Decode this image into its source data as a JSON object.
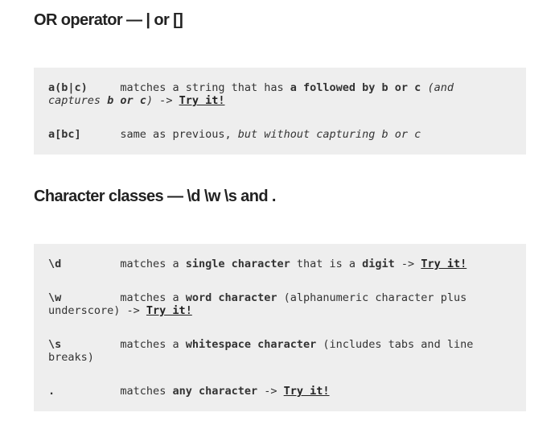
{
  "sections": [
    {
      "title": "OR operator — | or []",
      "rows": [
        {
          "code": "a(b|c)",
          "parts": [
            {
              "t": "matches a string that has "
            },
            {
              "t": "a followed by b or c",
              "b": true
            },
            {
              "t": " (and captures ",
              "i": true
            },
            {
              "t": "b or c",
              "b": true,
              "i": true
            },
            {
              "t": ") -> ",
              "i": true
            },
            {
              "t": "Try it!",
              "link": true
            }
          ]
        },
        {
          "code": "a[bc]",
          "parts": [
            {
              "t": "same as previous, "
            },
            {
              "t": "but without capturing b or c",
              "i": true
            }
          ]
        }
      ]
    },
    {
      "title": "Character classes — \\d \\w \\s and .",
      "rows": [
        {
          "code": "\\d",
          "parts": [
            {
              "t": "matches a "
            },
            {
              "t": "single character",
              "b": true
            },
            {
              "t": " that is a "
            },
            {
              "t": "digit",
              "b": true
            },
            {
              "t": " -> "
            },
            {
              "t": "Try it!",
              "link": true
            }
          ]
        },
        {
          "code": "\\w",
          "parts": [
            {
              "t": "matches a "
            },
            {
              "t": "word character",
              "b": true
            },
            {
              "t": " (alphanumeric character plus underscore) -> "
            },
            {
              "t": "Try it!",
              "link": true
            }
          ]
        },
        {
          "code": "\\s",
          "parts": [
            {
              "t": "matches a "
            },
            {
              "t": "whitespace character",
              "b": true
            },
            {
              "t": " (includes tabs and line breaks)"
            }
          ]
        },
        {
          "code": ".",
          "parts": [
            {
              "t": "matches "
            },
            {
              "t": "any character",
              "b": true
            },
            {
              "t": " -> "
            },
            {
              "t": "Try it!",
              "link": true
            }
          ]
        }
      ]
    }
  ]
}
